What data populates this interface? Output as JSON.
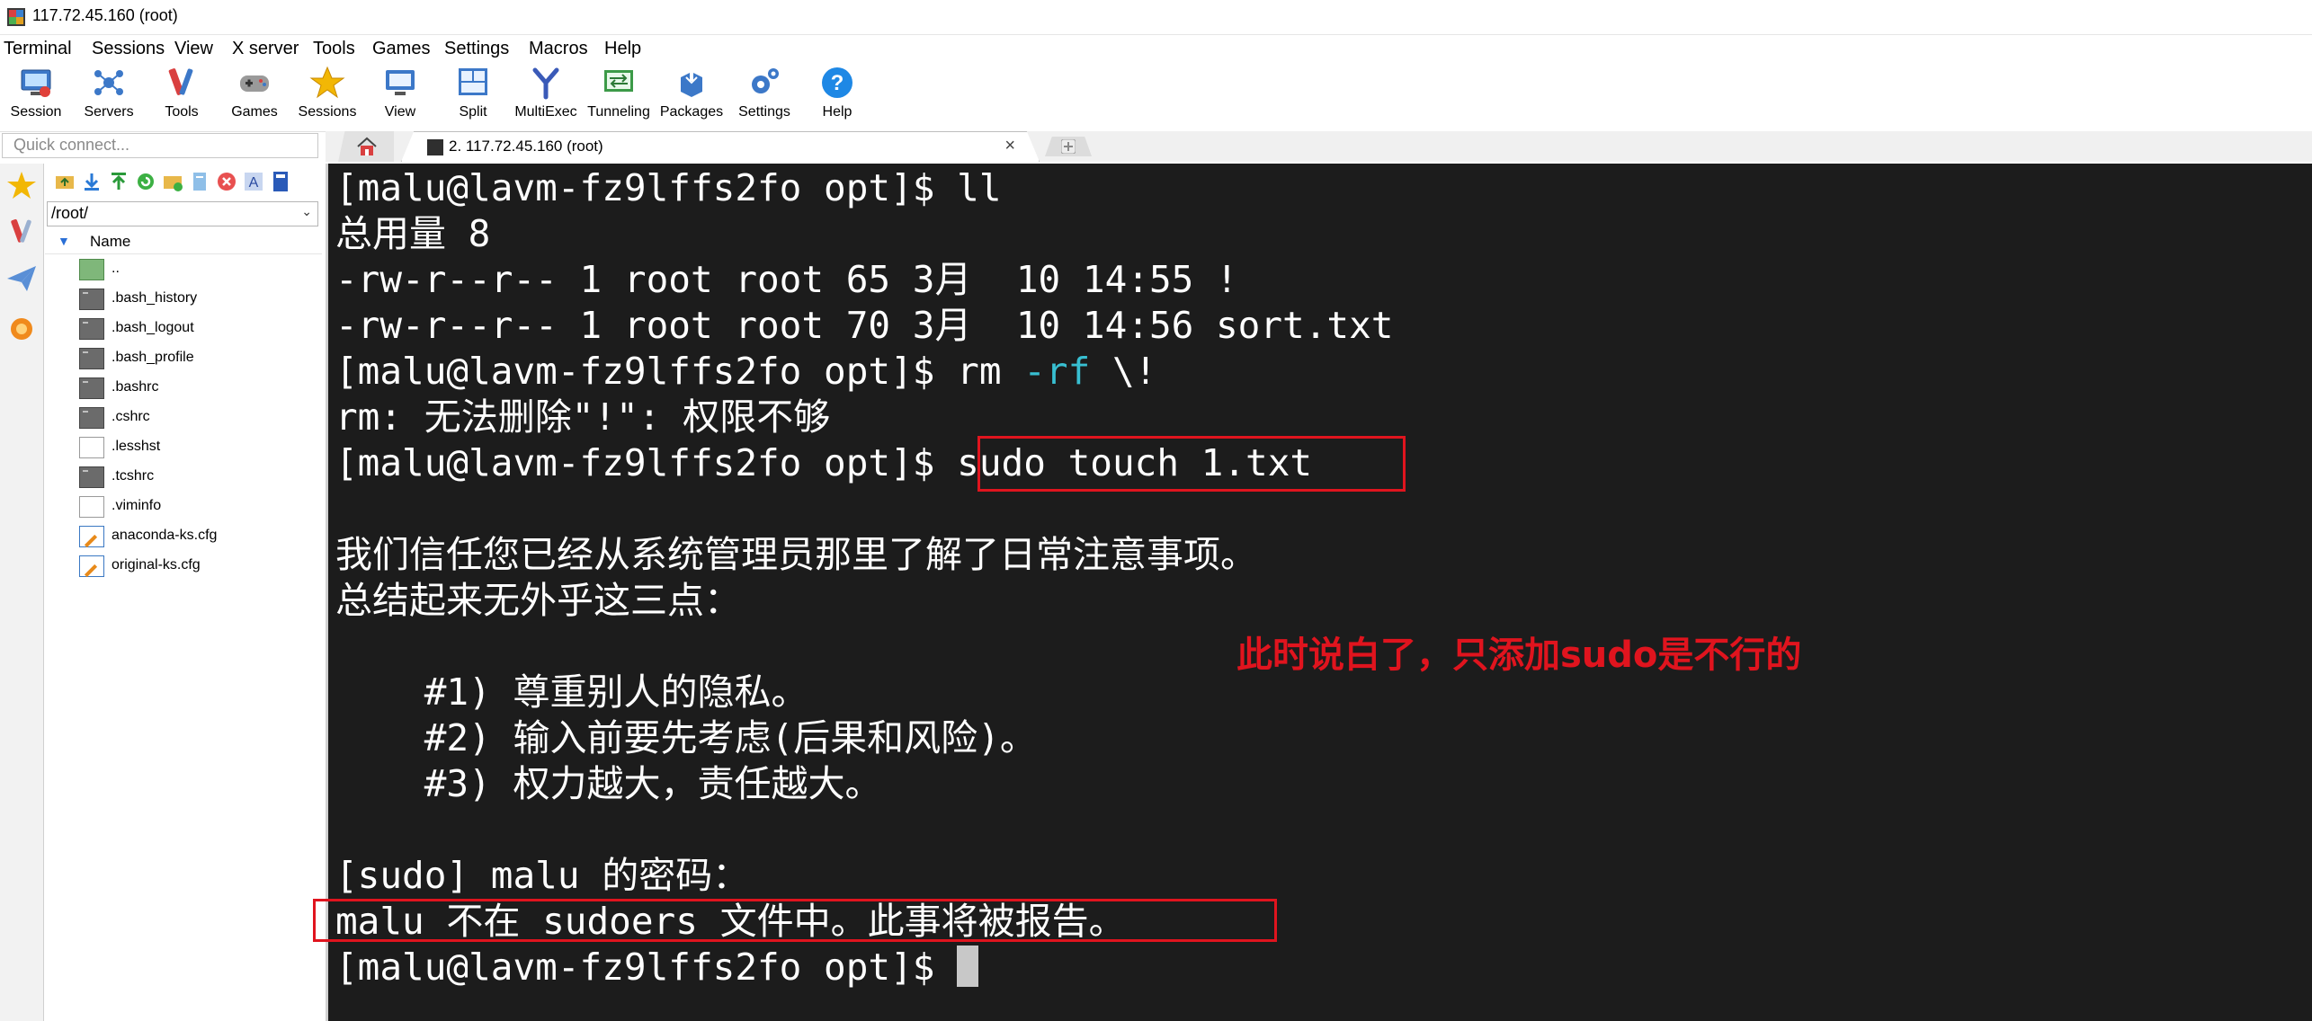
{
  "window": {
    "title": "117.72.45.160 (root)"
  },
  "menu": [
    "Terminal",
    "Sessions",
    "View",
    "X server",
    "Tools",
    "Games",
    "Settings",
    "Macros",
    "Help"
  ],
  "toolbar": [
    "Session",
    "Servers",
    "Tools",
    "Games",
    "Sessions",
    "View",
    "Split",
    "MultiExec",
    "Tunneling",
    "Packages",
    "Settings",
    "Help"
  ],
  "quick_connect": {
    "placeholder": "Quick connect..."
  },
  "tabs": {
    "session_tab": "2. 117.72.45.160 (root)",
    "close": "×"
  },
  "sftp": {
    "path": "/root/",
    "column_name": "Name",
    "files": [
      "..",
      ".bash_history",
      ".bash_logout",
      ".bash_profile",
      ".bashrc",
      ".cshrc",
      ".lesshst",
      ".tcshrc",
      ".viminfo",
      "anaconda-ks.cfg",
      "original-ks.cfg"
    ]
  },
  "terminal": {
    "lines": [
      {
        "prompt": "[malu@lavm-fz9lffs2fo opt]$ ",
        "cmd": "ll"
      },
      {
        "text": "总用量 8"
      },
      {
        "text": "-rw-r--r-- 1 root root 65 3月  10 14:55 !"
      },
      {
        "text": "-rw-r--r-- 1 root root 70 3月  10 14:56 sort.txt"
      },
      {
        "prompt": "[malu@lavm-fz9lffs2fo opt]$ ",
        "cmd_a": "rm ",
        "cmd_opt": "-rf",
        "cmd_b": " \\!"
      },
      {
        "text": "rm: 无法删除\"!\": 权限不够"
      },
      {
        "prompt": "[malu@lavm-fz9lffs2fo opt]$ ",
        "cmd": "sudo touch 1.txt"
      },
      {
        "text": ""
      },
      {
        "text": "我们信任您已经从系统管理员那里了解了日常注意事项。"
      },
      {
        "text": "总结起来无外乎这三点："
      },
      {
        "text": ""
      },
      {
        "text": "    #1) 尊重别人的隐私。"
      },
      {
        "text": "    #2) 输入前要先考虑(后果和风险)。"
      },
      {
        "text": "    #3) 权力越大，责任越大。"
      },
      {
        "text": ""
      },
      {
        "text": "[sudo] malu 的密码："
      },
      {
        "text": "malu 不在 sudoers 文件中。此事将被报告。"
      },
      {
        "prompt": "[malu@lavm-fz9lffs2fo opt]$ "
      }
    ],
    "annotation": "此时说白了，只添加sudo是不行的"
  },
  "colors": {
    "terminal_bg": "#1c1c1c",
    "terminal_fg": "#ffffff",
    "option_cyan": "#38bfd1",
    "annotation_red": "#e0141e"
  }
}
